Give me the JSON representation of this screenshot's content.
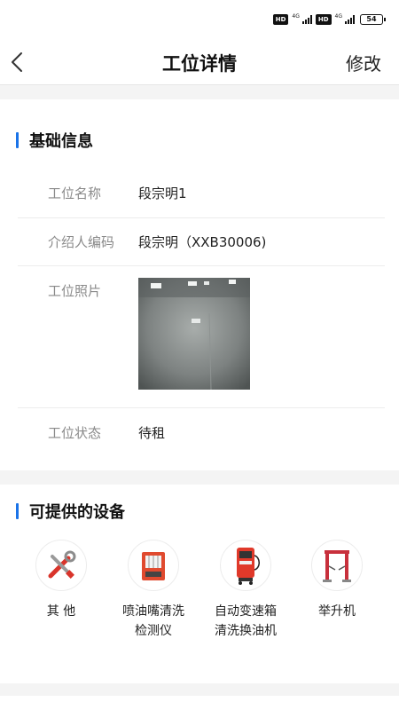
{
  "status_bar": {
    "hd1": "HD",
    "net1": "4G",
    "hd2": "HD",
    "net2": "4G",
    "battery": "54"
  },
  "nav": {
    "back_icon": "chevron-left-icon",
    "title": "工位详情",
    "edit_label": "修改"
  },
  "basic_info": {
    "section_title": "基础信息",
    "accent_color": "#1a73e8",
    "rows": [
      {
        "label": "工位名称",
        "value": "段宗明1"
      },
      {
        "label": "介绍人编码",
        "value": "段宗明（XXB30006)"
      },
      {
        "label": "工位照片"
      },
      {
        "label": "工位状态",
        "value": "待租"
      }
    ]
  },
  "equipment": {
    "section_title": "可提供的设备",
    "items": [
      {
        "label": "其 他",
        "icon": "tools-icon"
      },
      {
        "label": "喷油嘴清洗检测仪",
        "icon": "injector-cleaner-icon"
      },
      {
        "label": "自动变速箱清洗换油机",
        "icon": "transmission-oil-machine-icon"
      },
      {
        "label": "举升机",
        "icon": "car-lift-icon"
      }
    ]
  }
}
